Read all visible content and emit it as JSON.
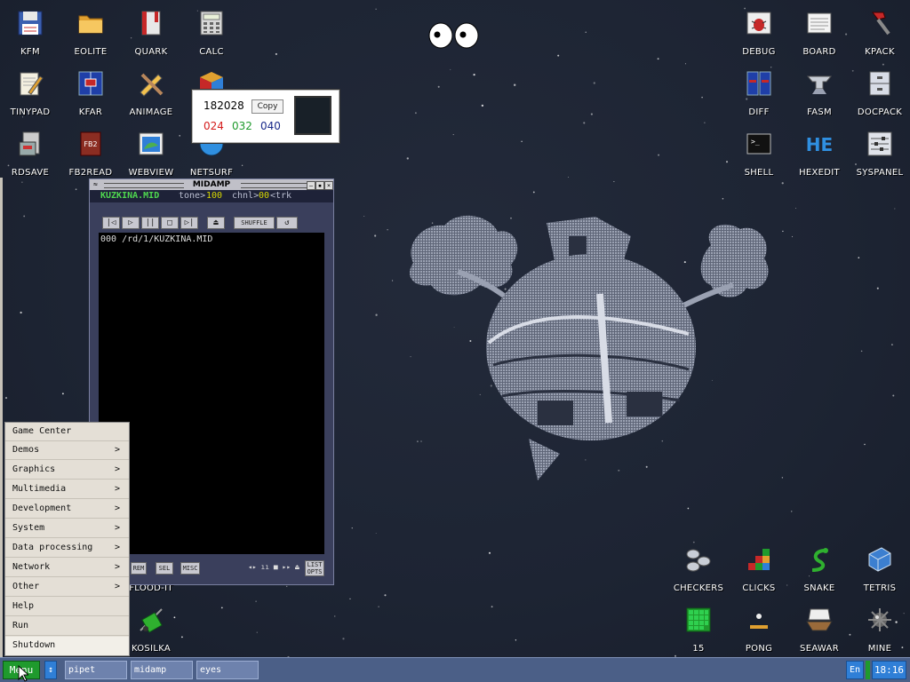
{
  "desktop_icons": [
    {
      "id": "kfm",
      "label": "KFM",
      "icon": "floppy-disk-icon"
    },
    {
      "id": "eolite",
      "label": "EOLITE",
      "icon": "folder-icon"
    },
    {
      "id": "quark",
      "label": "QUARK",
      "icon": "book-icon"
    },
    {
      "id": "calc",
      "label": "CALC",
      "icon": "calculator-icon"
    },
    {
      "id": "tinypad",
      "label": "TINYPAD",
      "icon": "notepad-icon"
    },
    {
      "id": "kfar",
      "label": "KFAR",
      "icon": "two-panel-icon"
    },
    {
      "id": "animage",
      "label": "ANIMAGE",
      "icon": "pencil-brush-icon"
    },
    {
      "id": "rdsave",
      "label": "RDSAVE",
      "icon": "save-disk-icon"
    },
    {
      "id": "fb2read",
      "label": "FB2READ",
      "icon": "fb2-book-icon"
    },
    {
      "id": "webview",
      "label": "WEBVIEW",
      "icon": "browser-icon"
    },
    {
      "id": "netsurf",
      "label": "NETSURF",
      "icon": "globe-icon"
    },
    {
      "id": "debug",
      "label": "DEBUG",
      "icon": "bug-icon"
    },
    {
      "id": "board",
      "label": "BOARD",
      "icon": "board-icon"
    },
    {
      "id": "kpack",
      "label": "KPACK",
      "icon": "hammer-icon"
    },
    {
      "id": "diff",
      "label": "DIFF",
      "icon": "diff-icon"
    },
    {
      "id": "fasm",
      "label": "FASM",
      "icon": "anvil-icon"
    },
    {
      "id": "docpack",
      "label": "DOCPACK",
      "icon": "cabinet-icon"
    },
    {
      "id": "shell",
      "label": "SHELL",
      "icon": "terminal-icon"
    },
    {
      "id": "hexedit",
      "label": "HEXEDIT",
      "icon": "hex-icon"
    },
    {
      "id": "syspanel",
      "label": "SYSPANEL",
      "icon": "sliders-icon"
    },
    {
      "id": "checkers",
      "label": "CHECKERS",
      "icon": "checkers-icon"
    },
    {
      "id": "clicks",
      "label": "CLICKS",
      "icon": "blocks-icon"
    },
    {
      "id": "snake",
      "label": "SNAKE",
      "icon": "snake-icon"
    },
    {
      "id": "tetris",
      "label": "TETRIS",
      "icon": "tetris-icon"
    },
    {
      "id": "fifteen",
      "label": "15",
      "icon": "grid-puzzle-icon"
    },
    {
      "id": "pong",
      "label": "PONG",
      "icon": "pong-icon"
    },
    {
      "id": "seawar",
      "label": "SEAWAR",
      "icon": "battleship-icon"
    },
    {
      "id": "mine",
      "label": "MINE",
      "icon": "mine-icon"
    },
    {
      "id": "floodit",
      "label": "FLOOD-IT",
      "icon": "flood-icon"
    },
    {
      "id": "kosilka",
      "label": "KOSILKA",
      "icon": "lawnmower-icon"
    }
  ],
  "color_picker": {
    "hex": "182028",
    "copy_label": "Copy",
    "r": "024",
    "g": "032",
    "b": "040",
    "r_color": "#d41c1c",
    "g_color": "#1f9a2d",
    "b_color": "#1a2a8a",
    "swatch_color": "#182028"
  },
  "midamp": {
    "title": "MIDAMP",
    "file_name": "KUZKINA.MID",
    "tone_label": "tone>",
    "tone_value": "100",
    "chnl_label": "chnl>",
    "chnl_value": "00",
    "trk_label": "<trk",
    "shuffle_label": "SHUFFLE",
    "playlist": [
      {
        "num": "000",
        "path": "/rd/1/KUZKINA.MID"
      }
    ],
    "rem_label": "REM",
    "sel_label": "SEL",
    "misc_label": "MISC",
    "list_label": "LIST",
    "opts_label": "OPTS"
  },
  "start_menu": {
    "items": [
      {
        "label": "Game Center",
        "submenu": false
      },
      {
        "label": "Demos",
        "submenu": true
      },
      {
        "label": "Graphics",
        "submenu": true
      },
      {
        "label": "Multimedia",
        "submenu": true
      },
      {
        "label": "Development",
        "submenu": true
      },
      {
        "label": "System",
        "submenu": true
      },
      {
        "label": "Data processing",
        "submenu": true
      },
      {
        "label": "Network",
        "submenu": true
      },
      {
        "label": "Other",
        "submenu": true
      },
      {
        "label": "Help",
        "submenu": false
      },
      {
        "label": "Run",
        "submenu": false
      },
      {
        "label": "Shutdown",
        "submenu": false
      }
    ],
    "arrow": ">"
  },
  "taskbar": {
    "menu_label": "Menu",
    "switch_glyph": "↕",
    "tasks": [
      {
        "label": "pipet"
      },
      {
        "label": "midamp"
      },
      {
        "label": "eyes"
      }
    ],
    "lang": "En",
    "clock": "18:16"
  },
  "colors": {
    "desktop_bg": "#1d2433",
    "taskbar_bg": "#4b5f87",
    "menu_bg": "#e4dfd6",
    "accent_green": "#1f9a2d",
    "accent_blue": "#2f7fd7",
    "midamp_yellow": "#d8d800",
    "midamp_green": "#4fd84f"
  }
}
